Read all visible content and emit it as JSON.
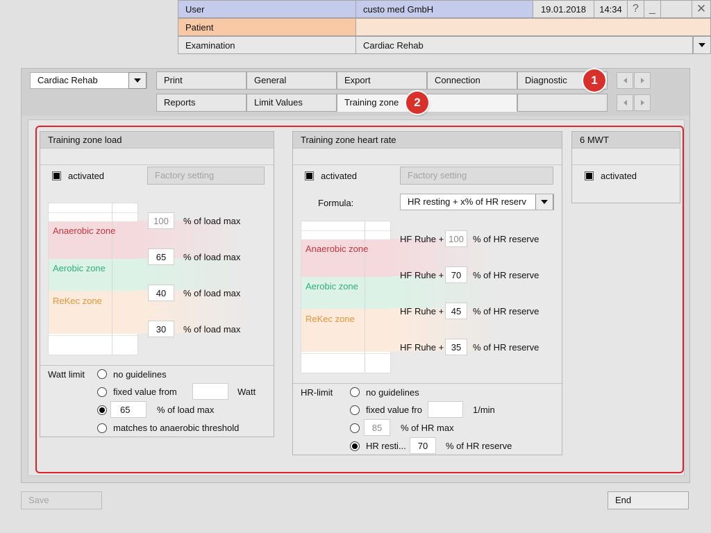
{
  "header": {
    "user_label": "User",
    "user_value": "custo med GmbH",
    "date": "19.01.2018",
    "time": "14:34",
    "help_icon": "?",
    "minimize_icon": "_",
    "close_icon": "✕",
    "patient_label": "Patient",
    "patient_value": "",
    "exam_label": "Examination",
    "exam_value": "Cardiac Rehab"
  },
  "toolbar": {
    "program_selected": "Cardiac Rehab",
    "tabs_row1": [
      "Print",
      "General",
      "Export",
      "Connection",
      "Diagnostic"
    ],
    "tabs_row2": [
      "Reports",
      "Limit Values",
      "Training zone",
      ""
    ],
    "badge1": "1",
    "badge2": "2"
  },
  "load_section": {
    "title": "Training zone load",
    "activated_label": "activated",
    "activated_checked": true,
    "factory_button": "Factory setting",
    "zones": {
      "anaerobic": "Anaerobic zone",
      "aerobic": "Aerobic zone",
      "rekec": "ReKec zone"
    },
    "thresholds": [
      {
        "value": "100",
        "unit": "% of load max",
        "dim": true
      },
      {
        "value": "65",
        "unit": "% of load max",
        "dim": false
      },
      {
        "value": "40",
        "unit": "% of load max",
        "dim": false
      },
      {
        "value": "30",
        "unit": "% of load max",
        "dim": false
      }
    ],
    "watt_limit_label": "Watt limit",
    "options": {
      "no_guidelines": "no guidelines",
      "fixed_value": "fixed value from",
      "fixed_unit": "Watt",
      "fixed_input": "",
      "percent_input": "65",
      "percent_unit": "% of load max",
      "anaerobic": "matches to anaerobic threshold"
    },
    "selected_option": "percent"
  },
  "hr_section": {
    "title": "Training zone heart rate",
    "activated_label": "activated",
    "activated_checked": true,
    "factory_button": "Factory setting",
    "formula_label": "Formula:",
    "formula_value": "HR resting + x% of HR reserv",
    "zones": {
      "anaerobic": "Anaerobic zone",
      "aerobic": "Aerobic zone",
      "rekec": "ReKec zone"
    },
    "thresholds": [
      {
        "prefix": "HF Ruhe +",
        "value": "100",
        "unit": "% of HR reserve",
        "dim": true
      },
      {
        "prefix": "HF Ruhe +",
        "value": "70",
        "unit": "% of HR reserve",
        "dim": false
      },
      {
        "prefix": "HF Ruhe +",
        "value": "45",
        "unit": "% of HR reserve",
        "dim": false
      },
      {
        "prefix": "HF Ruhe +",
        "value": "35",
        "unit": "% of HR reserve",
        "dim": false
      }
    ],
    "hr_limit_label": "HR-limit",
    "options": {
      "no_guidelines": "no guidelines",
      "fixed_value": "fixed value fro",
      "fixed_input": "",
      "fixed_unit": "1/min",
      "hrmax_input": "85",
      "hrmax_unit": "% of HR max",
      "reserve_label": "HR resti...",
      "reserve_input": "70",
      "reserve_unit": "% of HR reserve"
    },
    "selected_option": "reserve"
  },
  "mwt_section": {
    "title": "6 MWT",
    "activated_label": "activated",
    "activated_checked": true
  },
  "footer": {
    "save_label": "Save",
    "end_label": "End"
  },
  "colors": {
    "accent_red": "#e2202a",
    "anaerobic": "#c8353d",
    "aerobic": "#2fb07a",
    "rekec": "#e8943a"
  }
}
